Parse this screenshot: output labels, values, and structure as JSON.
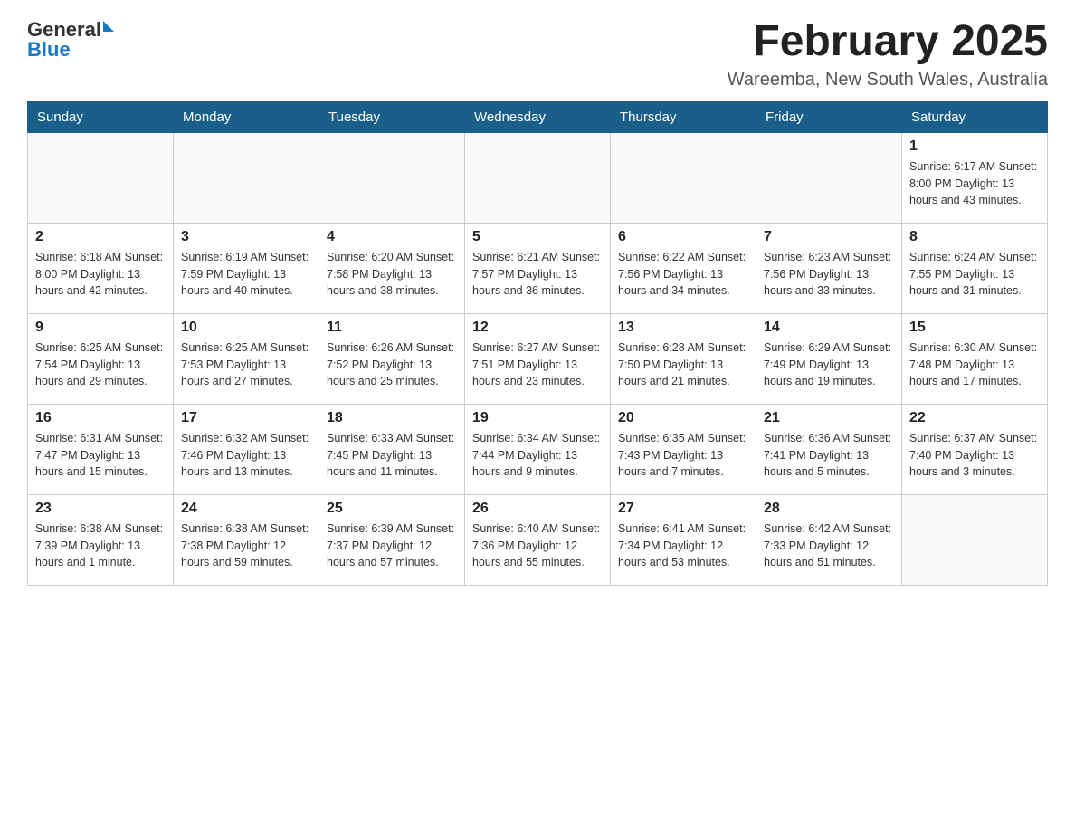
{
  "header": {
    "logo_general": "General",
    "logo_blue": "Blue",
    "month_title": "February 2025",
    "location": "Wareemba, New South Wales, Australia"
  },
  "days_of_week": [
    "Sunday",
    "Monday",
    "Tuesday",
    "Wednesday",
    "Thursday",
    "Friday",
    "Saturday"
  ],
  "weeks": [
    [
      {
        "day": "",
        "info": ""
      },
      {
        "day": "",
        "info": ""
      },
      {
        "day": "",
        "info": ""
      },
      {
        "day": "",
        "info": ""
      },
      {
        "day": "",
        "info": ""
      },
      {
        "day": "",
        "info": ""
      },
      {
        "day": "1",
        "info": "Sunrise: 6:17 AM\nSunset: 8:00 PM\nDaylight: 13 hours and 43 minutes."
      }
    ],
    [
      {
        "day": "2",
        "info": "Sunrise: 6:18 AM\nSunset: 8:00 PM\nDaylight: 13 hours and 42 minutes."
      },
      {
        "day": "3",
        "info": "Sunrise: 6:19 AM\nSunset: 7:59 PM\nDaylight: 13 hours and 40 minutes."
      },
      {
        "day": "4",
        "info": "Sunrise: 6:20 AM\nSunset: 7:58 PM\nDaylight: 13 hours and 38 minutes."
      },
      {
        "day": "5",
        "info": "Sunrise: 6:21 AM\nSunset: 7:57 PM\nDaylight: 13 hours and 36 minutes."
      },
      {
        "day": "6",
        "info": "Sunrise: 6:22 AM\nSunset: 7:56 PM\nDaylight: 13 hours and 34 minutes."
      },
      {
        "day": "7",
        "info": "Sunrise: 6:23 AM\nSunset: 7:56 PM\nDaylight: 13 hours and 33 minutes."
      },
      {
        "day": "8",
        "info": "Sunrise: 6:24 AM\nSunset: 7:55 PM\nDaylight: 13 hours and 31 minutes."
      }
    ],
    [
      {
        "day": "9",
        "info": "Sunrise: 6:25 AM\nSunset: 7:54 PM\nDaylight: 13 hours and 29 minutes."
      },
      {
        "day": "10",
        "info": "Sunrise: 6:25 AM\nSunset: 7:53 PM\nDaylight: 13 hours and 27 minutes."
      },
      {
        "day": "11",
        "info": "Sunrise: 6:26 AM\nSunset: 7:52 PM\nDaylight: 13 hours and 25 minutes."
      },
      {
        "day": "12",
        "info": "Sunrise: 6:27 AM\nSunset: 7:51 PM\nDaylight: 13 hours and 23 minutes."
      },
      {
        "day": "13",
        "info": "Sunrise: 6:28 AM\nSunset: 7:50 PM\nDaylight: 13 hours and 21 minutes."
      },
      {
        "day": "14",
        "info": "Sunrise: 6:29 AM\nSunset: 7:49 PM\nDaylight: 13 hours and 19 minutes."
      },
      {
        "day": "15",
        "info": "Sunrise: 6:30 AM\nSunset: 7:48 PM\nDaylight: 13 hours and 17 minutes."
      }
    ],
    [
      {
        "day": "16",
        "info": "Sunrise: 6:31 AM\nSunset: 7:47 PM\nDaylight: 13 hours and 15 minutes."
      },
      {
        "day": "17",
        "info": "Sunrise: 6:32 AM\nSunset: 7:46 PM\nDaylight: 13 hours and 13 minutes."
      },
      {
        "day": "18",
        "info": "Sunrise: 6:33 AM\nSunset: 7:45 PM\nDaylight: 13 hours and 11 minutes."
      },
      {
        "day": "19",
        "info": "Sunrise: 6:34 AM\nSunset: 7:44 PM\nDaylight: 13 hours and 9 minutes."
      },
      {
        "day": "20",
        "info": "Sunrise: 6:35 AM\nSunset: 7:43 PM\nDaylight: 13 hours and 7 minutes."
      },
      {
        "day": "21",
        "info": "Sunrise: 6:36 AM\nSunset: 7:41 PM\nDaylight: 13 hours and 5 minutes."
      },
      {
        "day": "22",
        "info": "Sunrise: 6:37 AM\nSunset: 7:40 PM\nDaylight: 13 hours and 3 minutes."
      }
    ],
    [
      {
        "day": "23",
        "info": "Sunrise: 6:38 AM\nSunset: 7:39 PM\nDaylight: 13 hours and 1 minute."
      },
      {
        "day": "24",
        "info": "Sunrise: 6:38 AM\nSunset: 7:38 PM\nDaylight: 12 hours and 59 minutes."
      },
      {
        "day": "25",
        "info": "Sunrise: 6:39 AM\nSunset: 7:37 PM\nDaylight: 12 hours and 57 minutes."
      },
      {
        "day": "26",
        "info": "Sunrise: 6:40 AM\nSunset: 7:36 PM\nDaylight: 12 hours and 55 minutes."
      },
      {
        "day": "27",
        "info": "Sunrise: 6:41 AM\nSunset: 7:34 PM\nDaylight: 12 hours and 53 minutes."
      },
      {
        "day": "28",
        "info": "Sunrise: 6:42 AM\nSunset: 7:33 PM\nDaylight: 12 hours and 51 minutes."
      },
      {
        "day": "",
        "info": ""
      }
    ]
  ]
}
